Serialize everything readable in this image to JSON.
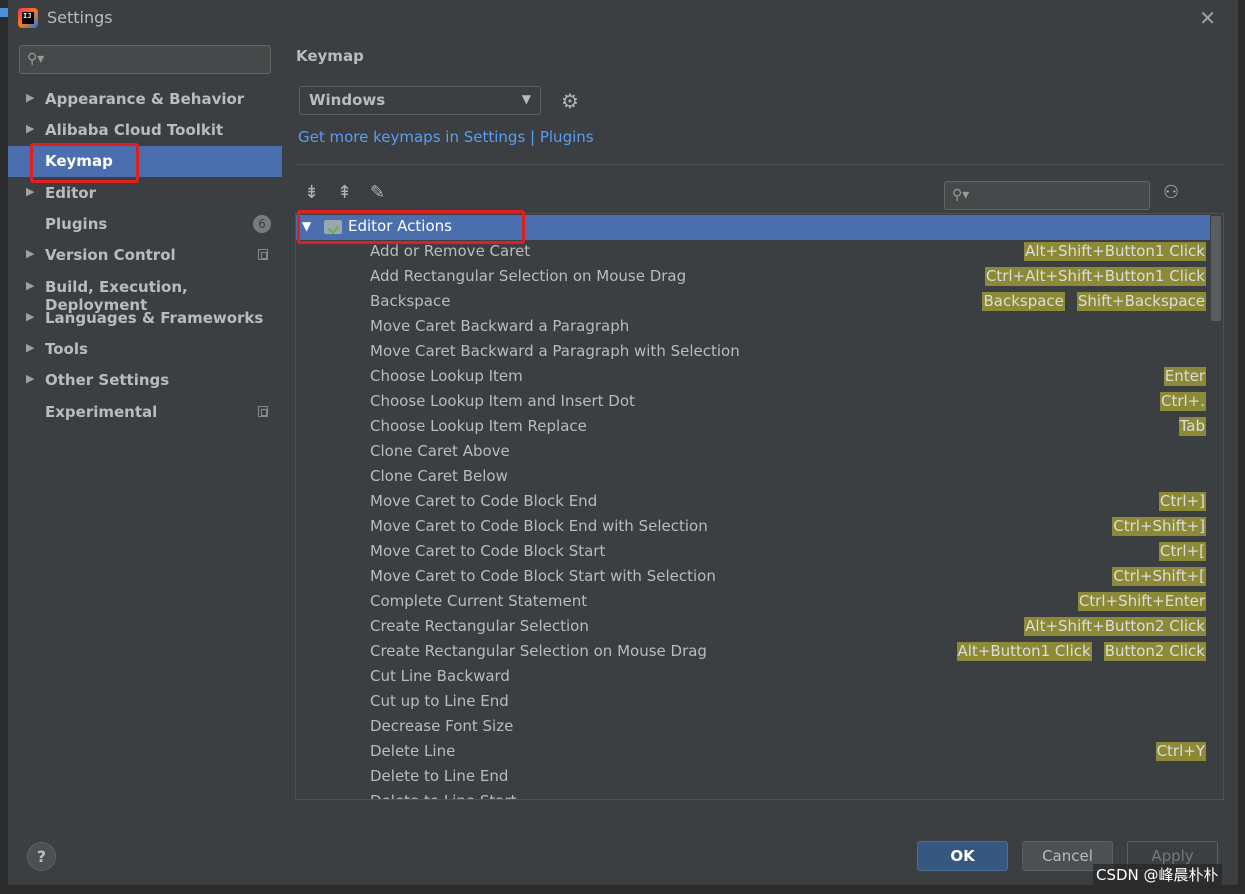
{
  "window": {
    "title": "Settings",
    "close_glyph": "✕"
  },
  "sidebar": {
    "search_placeholder": "",
    "items": [
      {
        "label": "Appearance & Behavior",
        "expandable": true
      },
      {
        "label": "Alibaba Cloud Toolkit",
        "expandable": true
      },
      {
        "label": "Keymap",
        "expandable": false,
        "selected": true
      },
      {
        "label": "Editor",
        "expandable": true
      },
      {
        "label": "Plugins",
        "expandable": false,
        "badge": "6"
      },
      {
        "label": "Version Control",
        "expandable": true,
        "project_icon": true
      },
      {
        "label": "Build, Execution, Deployment",
        "expandable": true
      },
      {
        "label": "Languages & Frameworks",
        "expandable": true
      },
      {
        "label": "Tools",
        "expandable": true
      },
      {
        "label": "Other Settings",
        "expandable": true
      },
      {
        "label": "Experimental",
        "expandable": false,
        "project_icon": true
      }
    ]
  },
  "main": {
    "heading": "Keymap",
    "keymap_select": "Windows",
    "link": "Get more keymaps in Settings | Plugins",
    "tree_search_placeholder": "",
    "group": "Editor Actions",
    "actions": [
      {
        "name": "Add or Remove Caret",
        "keys": [
          "Alt+Shift+Button1 Click"
        ]
      },
      {
        "name": "Add Rectangular Selection on Mouse Drag",
        "keys": [
          "Ctrl+Alt+Shift+Button1 Click"
        ]
      },
      {
        "name": "Backspace",
        "keys": [
          "Backspace",
          "Shift+Backspace"
        ]
      },
      {
        "name": "Move Caret Backward a Paragraph",
        "keys": []
      },
      {
        "name": "Move Caret Backward a Paragraph with Selection",
        "keys": []
      },
      {
        "name": "Choose Lookup Item",
        "keys": [
          "Enter"
        ]
      },
      {
        "name": "Choose Lookup Item and Insert Dot",
        "keys": [
          "Ctrl+."
        ]
      },
      {
        "name": "Choose Lookup Item Replace",
        "keys": [
          "Tab"
        ]
      },
      {
        "name": "Clone Caret Above",
        "keys": []
      },
      {
        "name": "Clone Caret Below",
        "keys": []
      },
      {
        "name": "Move Caret to Code Block End",
        "keys": [
          "Ctrl+]"
        ]
      },
      {
        "name": "Move Caret to Code Block End with Selection",
        "keys": [
          "Ctrl+Shift+]"
        ]
      },
      {
        "name": "Move Caret to Code Block Start",
        "keys": [
          "Ctrl+["
        ]
      },
      {
        "name": "Move Caret to Code Block Start with Selection",
        "keys": [
          "Ctrl+Shift+["
        ]
      },
      {
        "name": "Complete Current Statement",
        "keys": [
          "Ctrl+Shift+Enter"
        ]
      },
      {
        "name": "Create Rectangular Selection",
        "keys": [
          "Alt+Shift+Button2 Click"
        ]
      },
      {
        "name": "Create Rectangular Selection on Mouse Drag",
        "keys": [
          "Alt+Button1 Click",
          "Button2 Click"
        ]
      },
      {
        "name": "Cut Line Backward",
        "keys": []
      },
      {
        "name": "Cut up to Line End",
        "keys": []
      },
      {
        "name": "Decrease Font Size",
        "keys": []
      },
      {
        "name": "Delete Line",
        "keys": [
          "Ctrl+Y"
        ]
      },
      {
        "name": "Delete to Line End",
        "keys": []
      },
      {
        "name": "Delete to Line Start",
        "keys": []
      }
    ]
  },
  "footer": {
    "help": "?",
    "ok": "OK",
    "cancel": "Cancel",
    "apply": "Apply",
    "watermark": "CSDN @峰晨朴朴"
  },
  "colors": {
    "selection": "#4b6eaf",
    "shortcut_bg": "#8c8a37",
    "link": "#589df6",
    "highlight_box": "#e02020"
  },
  "icons": {
    "expand_all": "expand-all-icon",
    "collapse_all": "collapse-all-icon",
    "edit": "pencil-icon",
    "settings": "gear-icon",
    "find_by_shortcut": "find-shortcut-icon"
  }
}
